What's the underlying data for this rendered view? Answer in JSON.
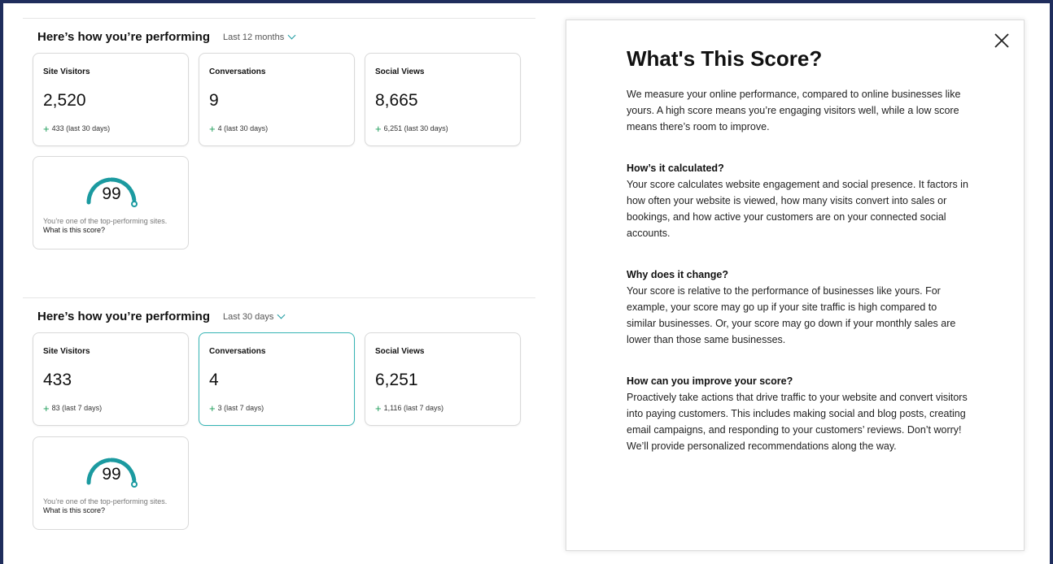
{
  "sections": [
    {
      "title": "Here’s how you’re performing",
      "range": "Last 12 months",
      "cards": [
        {
          "label": "Site Visitors",
          "value": "2,520",
          "delta": "433 (last 30 days)"
        },
        {
          "label": "Conversations",
          "value": "9",
          "delta": "4 (last 30 days)"
        },
        {
          "label": "Social Views",
          "value": "8,665",
          "delta": "6,251 (last 30 days)"
        }
      ],
      "score": {
        "value": "99",
        "text": "You’re one of the top-performing sites.",
        "link": "What is this score?"
      }
    },
    {
      "title": "Here’s how you’re performing",
      "range": "Last 30 days",
      "cards": [
        {
          "label": "Site Visitors",
          "value": "433",
          "delta": "83 (last 7 days)"
        },
        {
          "label": "Conversations",
          "value": "4",
          "delta": "3 (last 7 days)"
        },
        {
          "label": "Social Views",
          "value": "6,251",
          "delta": "1,116 (last 7 days)"
        }
      ],
      "score": {
        "value": "99",
        "text": "You’re one of the top-performing sites.",
        "link": "What is this score?"
      }
    }
  ],
  "modal": {
    "title": "What's This Score?",
    "intro": "We measure your online performance, compared to online businesses like yours. A high score means you’re engaging visitors well, while a low score means there’s room to improve.",
    "questions": [
      {
        "q": "How’s it calculated?",
        "a": "Your score calculates website engagement and social presence. It factors in how often your website is viewed, how many visits convert into sales or bookings, and how active your customers are on your connected social accounts."
      },
      {
        "q": "Why does it change?",
        "a": "Your score is relative to the performance of businesses like yours. For example, your score may go up if your site traffic is high compared to similar businesses. Or, your score may go down if your monthly sales are lower than those same businesses."
      },
      {
        "q": "How can you improve your score?",
        "a": "Proactively take actions that drive traffic to your website and convert visitors into paying customers. This includes making social and blog posts, creating email campaigns, and responding to your customers’ reviews. Don’t worry! We’ll provide personalized recommendations along the way."
      }
    ]
  },
  "colors": {
    "accent": "#1b9aa0",
    "positive": "#1e9d5a",
    "frame": "#1f2d5c"
  },
  "icons": {
    "close": "close-icon",
    "chevron": "chevron-down-icon",
    "gauge": "gauge-icon"
  }
}
